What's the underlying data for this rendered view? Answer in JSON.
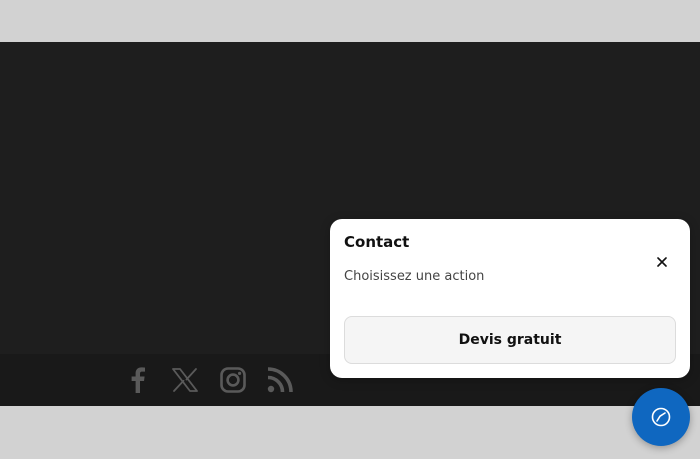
{
  "popup": {
    "title": "Contact",
    "subtitle": "Choisissez une action",
    "close_label": "×",
    "action_label": "Devis gratuit"
  },
  "footer": {
    "social_icons": [
      "facebook-icon",
      "x-icon",
      "instagram-icon",
      "rss-icon"
    ]
  },
  "fab": {
    "icon": "compass-icon"
  },
  "colors": {
    "dark_background": "#1e1e1e",
    "footer_background": "#191919",
    "light_band": "#d2d2d2",
    "social_icon": "#5a5a5a",
    "fab_accent": "#0f67c0",
    "popup_background": "#ffffff",
    "action_button_background": "#f5f5f5"
  }
}
